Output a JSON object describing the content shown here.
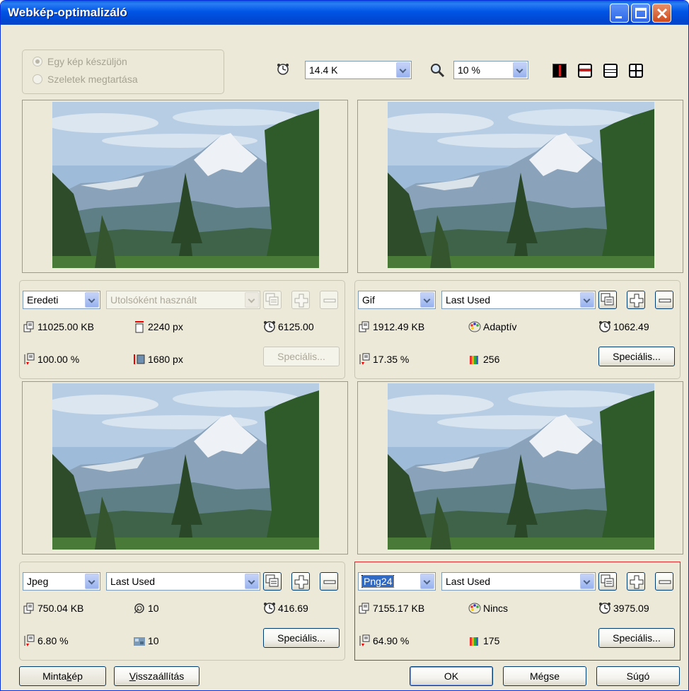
{
  "window": {
    "title": "Webkép-optimalizáló"
  },
  "mode": {
    "option_single": "Egy kép készüljön",
    "option_slices": "Szeletek megtartása"
  },
  "toolbar": {
    "speed_value": "14.4 K",
    "zoom_value": "10 %"
  },
  "panels": {
    "original": {
      "format": "Eredeti",
      "preset": "Utolsóként használt",
      "size": "11025.00 KB",
      "ratio": "100.00 %",
      "width": "2240 px",
      "height": "1680 px",
      "time": "6125.00",
      "special": "Speciális..."
    },
    "gif": {
      "format": "Gif",
      "preset": "Last Used",
      "size": "1912.49 KB",
      "ratio": "17.35 %",
      "palette": "Adaptív",
      "colors": "256",
      "time": "1062.49",
      "special": "Speciális..."
    },
    "jpeg": {
      "format": "Jpeg",
      "preset": "Last Used",
      "size": "750.04 KB",
      "ratio": "6.80 %",
      "quality": "10",
      "smoothing": "10",
      "time": "416.69",
      "special": "Speciális..."
    },
    "png": {
      "format": "Png24",
      "preset": "Last Used",
      "size": "7155.17 KB",
      "ratio": "64.90 %",
      "palette": "Nincs",
      "colors": "175",
      "time": "3975.09",
      "special": "Speciális..."
    }
  },
  "footer": {
    "sample_prefix": "Minta",
    "sample_key": "k",
    "sample_suffix": "ép",
    "reset_key": "V",
    "reset_suffix": "isszaállítás",
    "ok": "OK",
    "cancel": "Mégse",
    "help": "Súgó"
  }
}
